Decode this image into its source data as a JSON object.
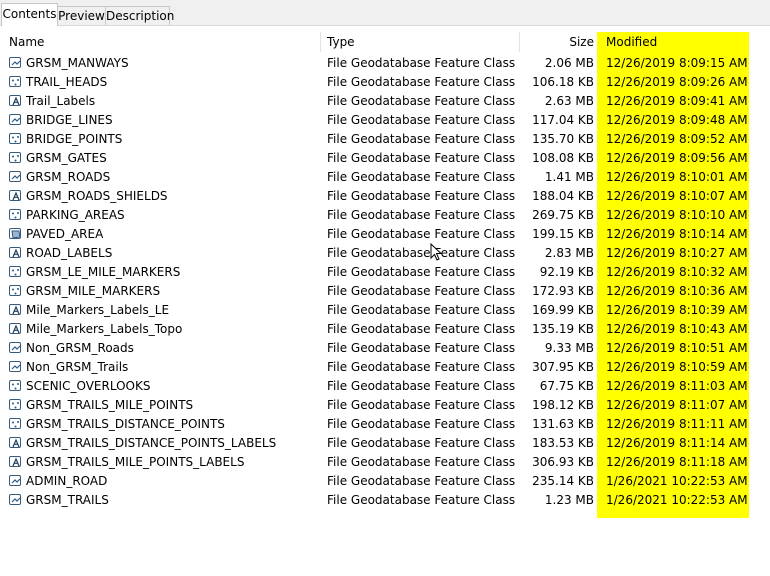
{
  "tabs": [
    {
      "label": "Contents",
      "active": true
    },
    {
      "label": "Preview",
      "active": false
    },
    {
      "label": "Description",
      "active": false
    }
  ],
  "columns": {
    "name": "Name",
    "type": "Type",
    "size": "Size",
    "modified": "Modified"
  },
  "highlight_color": "#ffff00",
  "rows": [
    {
      "icon": "line-feature-icon",
      "name": "GRSM_MANWAYS",
      "type": "File Geodatabase Feature Class",
      "size": "2.06 MB",
      "modified": "12/26/2019 8:09:15 AM"
    },
    {
      "icon": "point-feature-icon",
      "name": "TRAIL_HEADS",
      "type": "File Geodatabase Feature Class",
      "size": "106.18 KB",
      "modified": "12/26/2019 8:09:26 AM"
    },
    {
      "icon": "annotation-feature-icon",
      "name": "Trail_Labels",
      "type": "File Geodatabase Feature Class",
      "size": "2.63 MB",
      "modified": "12/26/2019 8:09:41 AM"
    },
    {
      "icon": "line-feature-icon",
      "name": "BRIDGE_LINES",
      "type": "File Geodatabase Feature Class",
      "size": "117.04 KB",
      "modified": "12/26/2019 8:09:48 AM"
    },
    {
      "icon": "point-feature-icon",
      "name": "BRIDGE_POINTS",
      "type": "File Geodatabase Feature Class",
      "size": "135.70 KB",
      "modified": "12/26/2019 8:09:52 AM"
    },
    {
      "icon": "point-feature-icon",
      "name": "GRSM_GATES",
      "type": "File Geodatabase Feature Class",
      "size": "108.08 KB",
      "modified": "12/26/2019 8:09:56 AM"
    },
    {
      "icon": "line-feature-icon",
      "name": "GRSM_ROADS",
      "type": "File Geodatabase Feature Class",
      "size": "1.41 MB",
      "modified": "12/26/2019 8:10:01 AM"
    },
    {
      "icon": "annotation-feature-icon",
      "name": "GRSM_ROADS_SHIELDS",
      "type": "File Geodatabase Feature Class",
      "size": "188.04 KB",
      "modified": "12/26/2019 8:10:07 AM"
    },
    {
      "icon": "point-feature-icon",
      "name": "PARKING_AREAS",
      "type": "File Geodatabase Feature Class",
      "size": "269.75 KB",
      "modified": "12/26/2019 8:10:10 AM"
    },
    {
      "icon": "polygon-feature-icon",
      "name": "PAVED_AREA",
      "type": "File Geodatabase Feature Class",
      "size": "199.15 KB",
      "modified": "12/26/2019 8:10:14 AM"
    },
    {
      "icon": "annotation-feature-icon",
      "name": "ROAD_LABELS",
      "type": "File Geodatabase Feature Class",
      "size": "2.83 MB",
      "modified": "12/26/2019 8:10:27 AM"
    },
    {
      "icon": "point-feature-icon",
      "name": "GRSM_LE_MILE_MARKERS",
      "type": "File Geodatabase Feature Class",
      "size": "92.19 KB",
      "modified": "12/26/2019 8:10:32 AM"
    },
    {
      "icon": "point-feature-icon",
      "name": "GRSM_MILE_MARKERS",
      "type": "File Geodatabase Feature Class",
      "size": "172.93 KB",
      "modified": "12/26/2019 8:10:36 AM"
    },
    {
      "icon": "annotation-feature-icon",
      "name": "Mile_Markers_Labels_LE",
      "type": "File Geodatabase Feature Class",
      "size": "169.99 KB",
      "modified": "12/26/2019 8:10:39 AM"
    },
    {
      "icon": "annotation-feature-icon",
      "name": "Mile_Markers_Labels_Topo",
      "type": "File Geodatabase Feature Class",
      "size": "135.19 KB",
      "modified": "12/26/2019 8:10:43 AM"
    },
    {
      "icon": "line-feature-icon",
      "name": "Non_GRSM_Roads",
      "type": "File Geodatabase Feature Class",
      "size": "9.33 MB",
      "modified": "12/26/2019 8:10:51 AM"
    },
    {
      "icon": "line-feature-icon",
      "name": "Non_GRSM_Trails",
      "type": "File Geodatabase Feature Class",
      "size": "307.95 KB",
      "modified": "12/26/2019 8:10:59 AM"
    },
    {
      "icon": "point-feature-icon",
      "name": "SCENIC_OVERLOOKS",
      "type": "File Geodatabase Feature Class",
      "size": "67.75 KB",
      "modified": "12/26/2019 8:11:03 AM"
    },
    {
      "icon": "point-feature-icon",
      "name": "GRSM_TRAILS_MILE_POINTS",
      "type": "File Geodatabase Feature Class",
      "size": "198.12 KB",
      "modified": "12/26/2019 8:11:07 AM"
    },
    {
      "icon": "point-feature-icon",
      "name": "GRSM_TRAILS_DISTANCE_POINTS",
      "type": "File Geodatabase Feature Class",
      "size": "131.63 KB",
      "modified": "12/26/2019 8:11:11 AM"
    },
    {
      "icon": "annotation-feature-icon",
      "name": "GRSM_TRAILS_DISTANCE_POINTS_LABELS",
      "type": "File Geodatabase Feature Class",
      "size": "183.53 KB",
      "modified": "12/26/2019 8:11:14 AM"
    },
    {
      "icon": "annotation-feature-icon",
      "name": "GRSM_TRAILS_MILE_POINTS_LABELS",
      "type": "File Geodatabase Feature Class",
      "size": "306.93 KB",
      "modified": "12/26/2019 8:11:18 AM"
    },
    {
      "icon": "line-feature-icon",
      "name": "ADMIN_ROAD",
      "type": "File Geodatabase Feature Class",
      "size": "235.14 KB",
      "modified": "1/26/2021 10:22:53 AM"
    },
    {
      "icon": "line-feature-icon",
      "name": "GRSM_TRAILS",
      "type": "File Geodatabase Feature Class",
      "size": "1.23 MB",
      "modified": "1/26/2021 10:22:53 AM"
    }
  ]
}
